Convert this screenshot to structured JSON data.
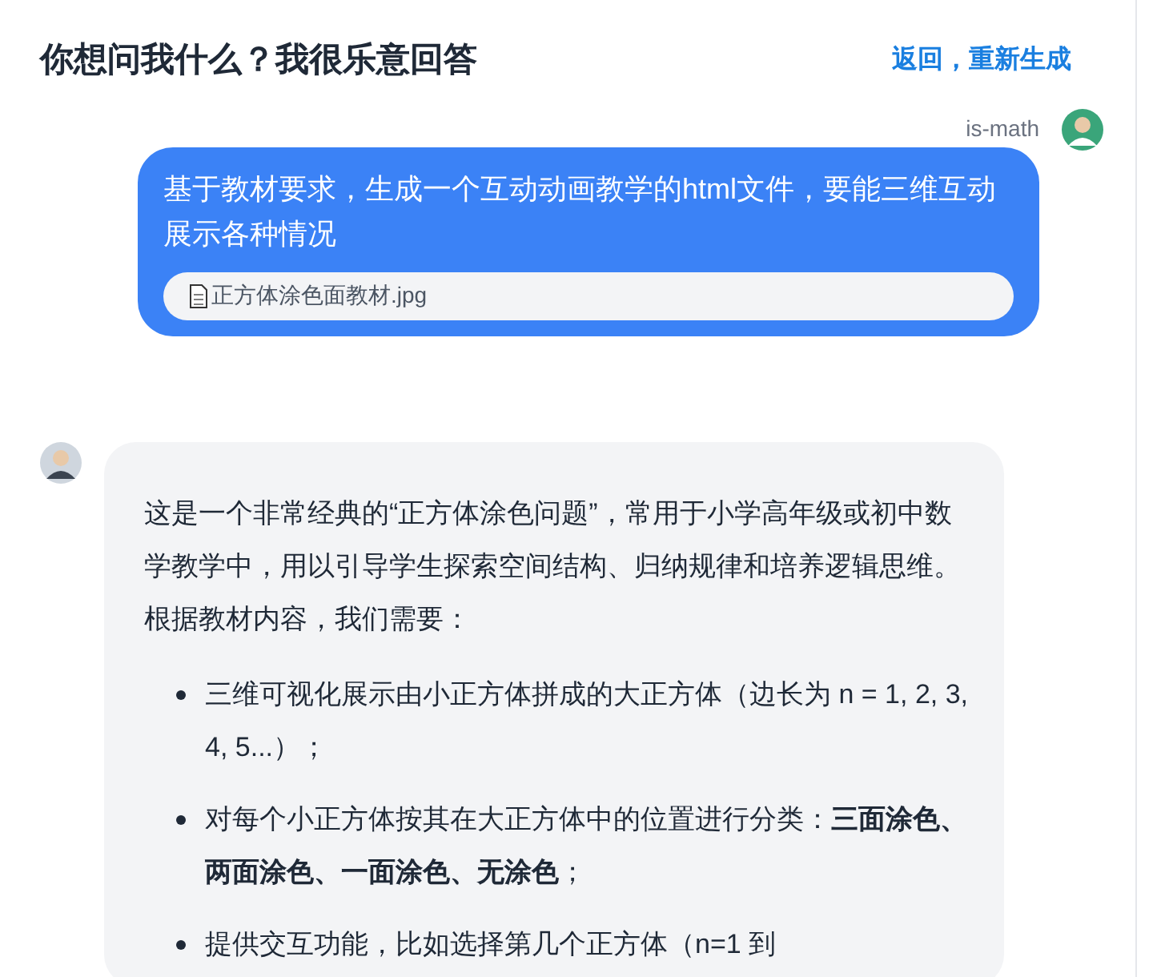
{
  "header": {
    "title": "你想问我什么？我很乐意回答",
    "action_link": "返回，重新生成"
  },
  "user_message": {
    "username": "is-math",
    "text": "基于教材要求，生成一个互动动画教学的html文件，要能三维互动展示各种情况",
    "attachment": "正方体涂色面教材.jpg"
  },
  "assistant_message": {
    "paragraph": "这是一个非常经典的“正方体涂色问题”，常用于小学高年级或初中数学教学中，用以引导学生探索空间结构、归纳规律和培养逻辑思维。根据教材内容，我们需要：",
    "bullets": [
      "三维可视化展示由小正方体拼成的大正方体（边长为 n = 1, 2, 3, 4, 5...）；",
      "对每个小正方体按其在大正方体中的位置进行分类：**三面涂色、两面涂色、一面涂色、无涂色**；",
      "提供交互功能，比如选择第几个正方体（n=1 到"
    ]
  }
}
